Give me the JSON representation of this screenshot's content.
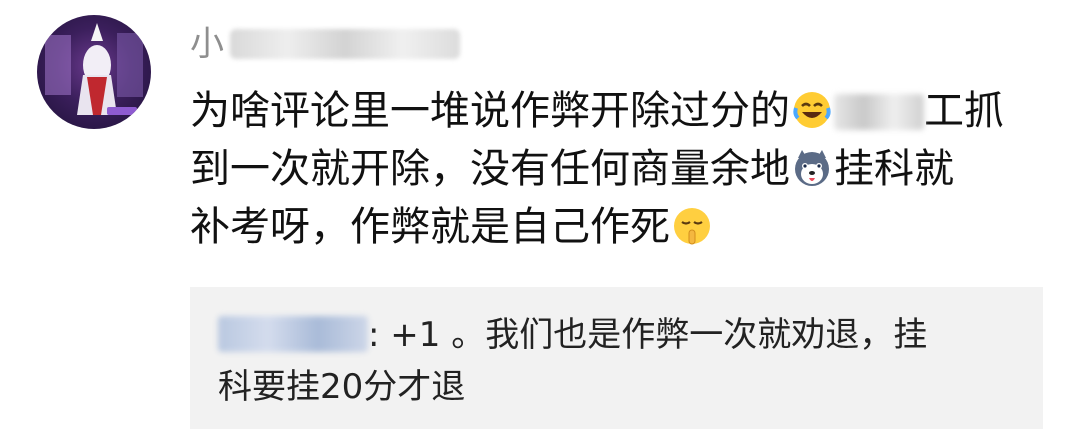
{
  "avatar": {
    "icon": "user-avatar-game-character"
  },
  "username": {
    "visible_prefix": "小"
  },
  "comment": {
    "lines": [
      {
        "text_before": "为啥评论里一堆说作弊开除过分的",
        "emoji": "laughing-crying-emoji",
        "text_after": "工抓"
      },
      {
        "text_before": "到一次就开除，没有任何商量余地",
        "emoji": "husky-dog-emoji",
        "text_after": "挂科就"
      },
      {
        "text_before": "补考呀，作弊就是自己作死",
        "emoji": "shush-face-emoji",
        "text_after": ""
      }
    ]
  },
  "reply": {
    "separator": ": ",
    "line1": "+1 。我们也是作弊一次就劝退，挂",
    "line2": "科要挂20分才退"
  }
}
